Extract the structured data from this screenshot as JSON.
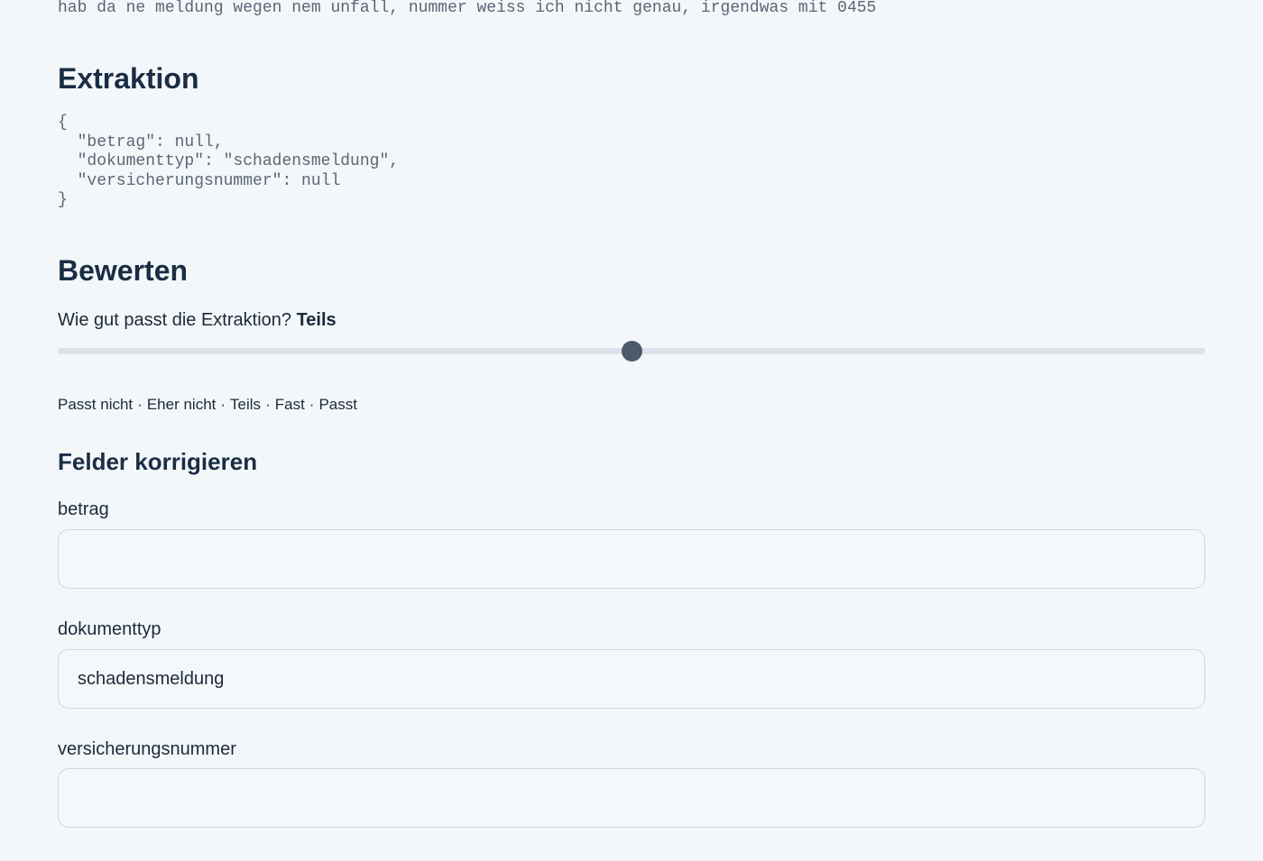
{
  "input_text": "hab da ne meldung wegen nem unfall, nummer weiss ich nicht genau, irgendwas mit 0455",
  "extraction": {
    "title": "Extraktion",
    "json_text": "{\n  \"betrag\": null,\n  \"dokumenttyp\": \"schadensmeldung\",\n  \"versicherungsnummer\": null\n}"
  },
  "rating": {
    "title": "Bewerten",
    "question": "Wie gut passt die Extraktion?",
    "current_label": "Teils",
    "slider_value_index": 2,
    "slider_max_index": 4,
    "scale_labels": [
      "Passt nicht",
      "Eher nicht",
      "Teils",
      "Fast",
      "Passt"
    ],
    "separator": "·"
  },
  "fields": {
    "title": "Felder korrigieren",
    "items": [
      {
        "label": "betrag",
        "value": ""
      },
      {
        "label": "dokumenttyp",
        "value": "schadensmeldung"
      },
      {
        "label": "versicherungsnummer",
        "value": ""
      }
    ]
  },
  "colors": {
    "background": "#f3f7fa",
    "heading": "#1a2d44",
    "slider_thumb": "#4e5a6b",
    "slider_track": "#dde2ea",
    "input_border": "#cfd5dd"
  }
}
